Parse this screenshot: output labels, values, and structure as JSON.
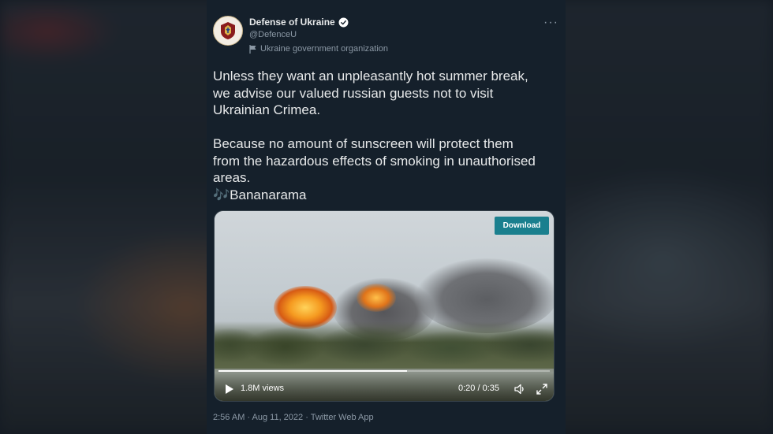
{
  "account": {
    "name": "Defense of Ukraine",
    "handle": "@DefenceU",
    "label": "Ukraine government organization"
  },
  "tweet": {
    "lines1": [
      "Unless they want an unpleasantly hot summer break,",
      "we advise our valued russian guests not to visit",
      "Ukrainian Crimea."
    ],
    "lines2": [
      "Because no amount of sunscreen will protect them",
      "from the hazardous effects of smoking in unauthorised",
      "areas."
    ],
    "emoji": "🎶",
    "song": "Bananarama"
  },
  "video": {
    "download_label": "Download",
    "views": "1.8M views",
    "time": "0:20 / 0:35",
    "progress_fraction": 0.57
  },
  "footer": {
    "meta": "2:56 AM · Aug 11, 2022 · Twitter Web App"
  },
  "colors": {
    "card_bg": "#15202b",
    "accent": "#1d9bf0",
    "download_bg": "#1a7f8e",
    "muted": "#8b98a5"
  },
  "icons": [
    "verified-badge-icon",
    "flag-icon",
    "more-icon",
    "play-icon",
    "volume-icon",
    "fullscreen-icon"
  ]
}
